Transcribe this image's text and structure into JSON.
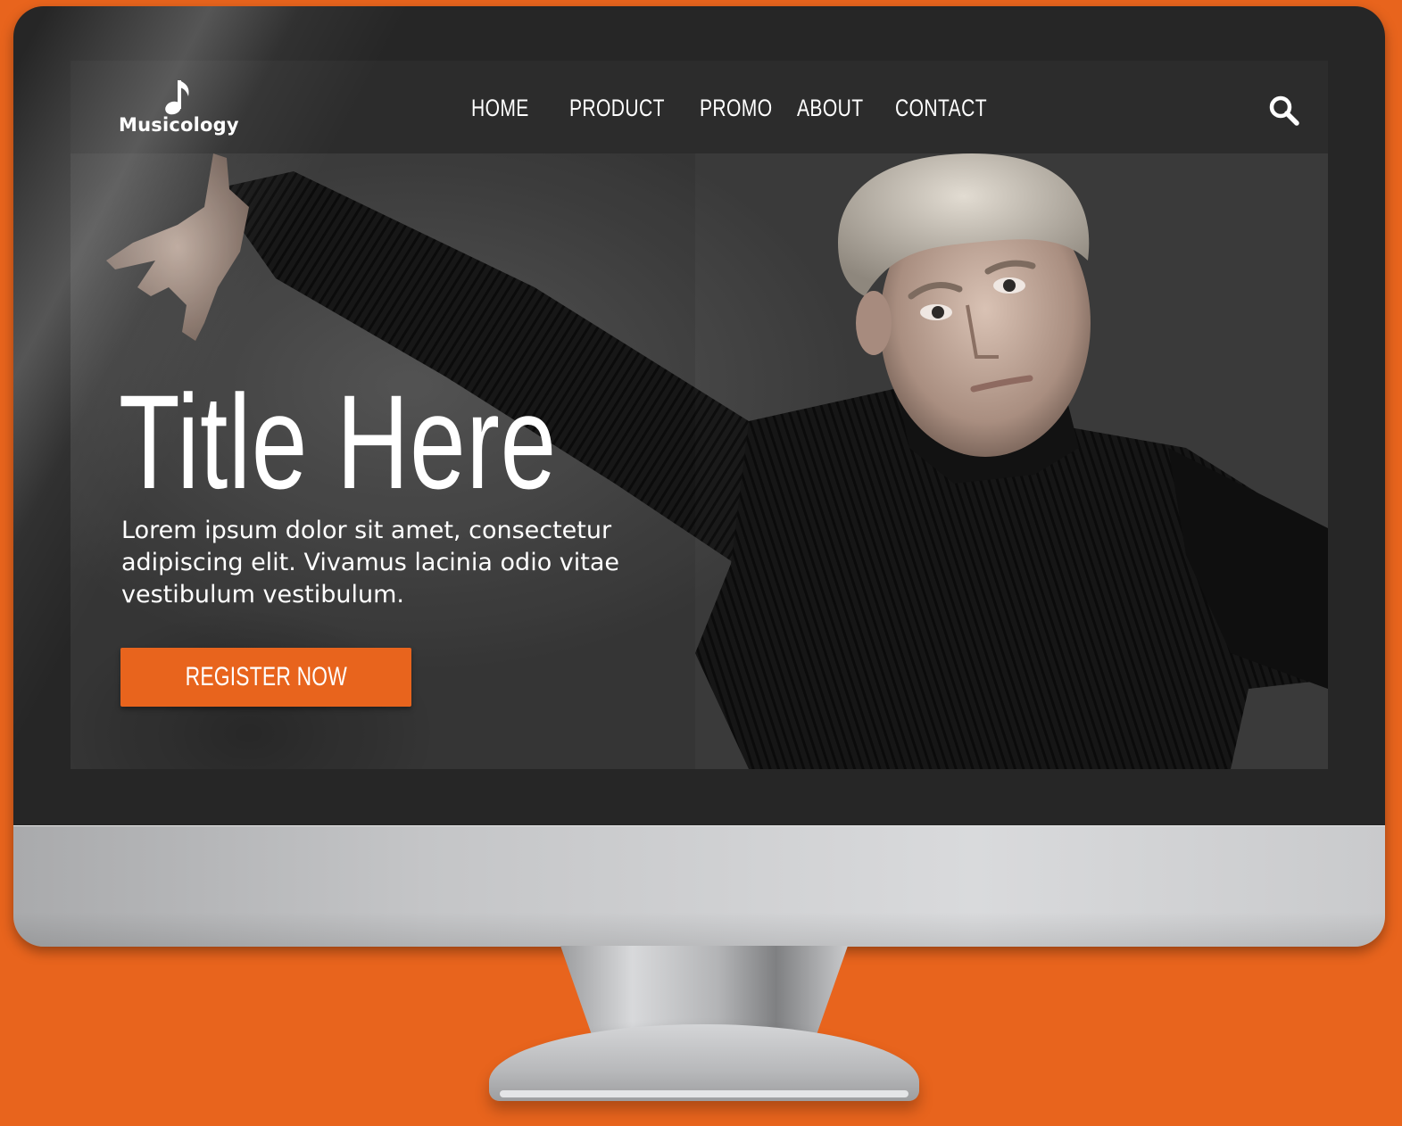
{
  "brand": {
    "name": "Musicology",
    "logo_icon": "music-note-icon"
  },
  "nav": {
    "items": [
      {
        "label": "HOME"
      },
      {
        "label": "PRODUCT"
      },
      {
        "label": "PROMO"
      },
      {
        "label": "ABOUT"
      },
      {
        "label": "CONTACT"
      }
    ],
    "search_icon": "search-icon"
  },
  "hero": {
    "title": "Title Here",
    "text": "Lorem ipsum dolor sit amet, consectetur adipiscing elit. Vivamus lacinia odio vitae vestibulum vestibulum.",
    "cta_label": "REGISTER NOW",
    "image": "man in black turtleneck sweater with outstretched arm"
  },
  "colors": {
    "accent": "#e8641d",
    "navbar": "#2c2c2c",
    "bezel": "#262626",
    "text": "#ffffff"
  }
}
